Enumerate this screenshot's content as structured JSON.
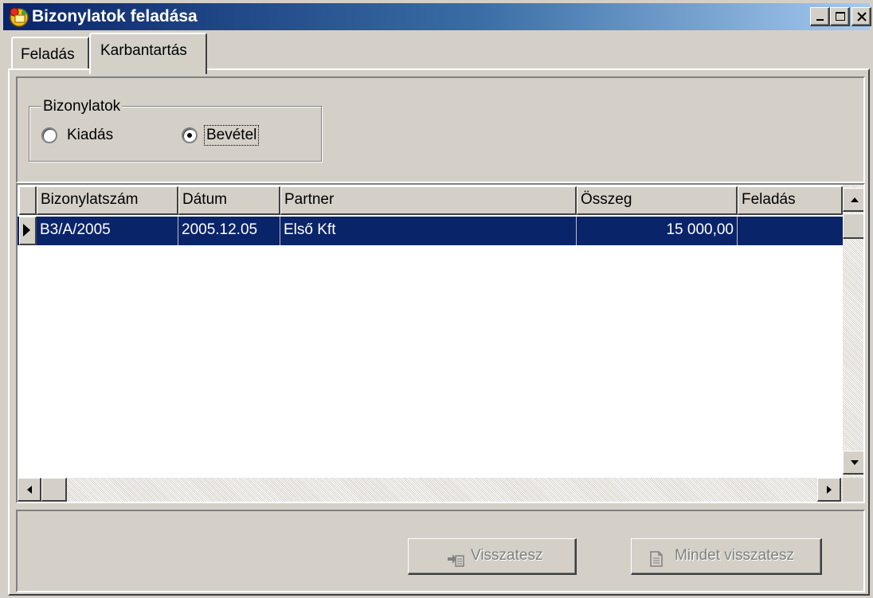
{
  "window": {
    "title": "Bizonylatok feladása",
    "icon": "app-icon",
    "controls": [
      "minimize-icon",
      "maximize-icon",
      "close-icon"
    ]
  },
  "tabs": [
    {
      "label": "Feladás",
      "active": false
    },
    {
      "label": "Karbantartás",
      "active": true
    }
  ],
  "group": {
    "label": "Bizonylatok",
    "options": [
      {
        "label": "Kiadás",
        "selected": false
      },
      {
        "label": "Bevétel",
        "selected": true
      }
    ]
  },
  "grid": {
    "columns": [
      "Bizonylatszám",
      "Dátum",
      "Partner",
      "Összeg",
      "Feladás"
    ],
    "rows": [
      {
        "bizonylatszam": "B3/A/2005",
        "datum": "2005.12.05",
        "partner": "Első Kft",
        "osszeg": "15 000,00",
        "feladas": ""
      }
    ],
    "selected_row": 0
  },
  "buttons": {
    "visszatesz": {
      "label": "Visszatesz",
      "icon": "move-back-icon",
      "enabled": false
    },
    "mindet": {
      "label": "Mindet visszatesz",
      "icon": "document-icon",
      "enabled": false
    }
  },
  "colors": {
    "face": "#d4d0c8",
    "selection": "#0a246a",
    "title_start": "#0a246a",
    "title_end": "#a6caf0"
  }
}
